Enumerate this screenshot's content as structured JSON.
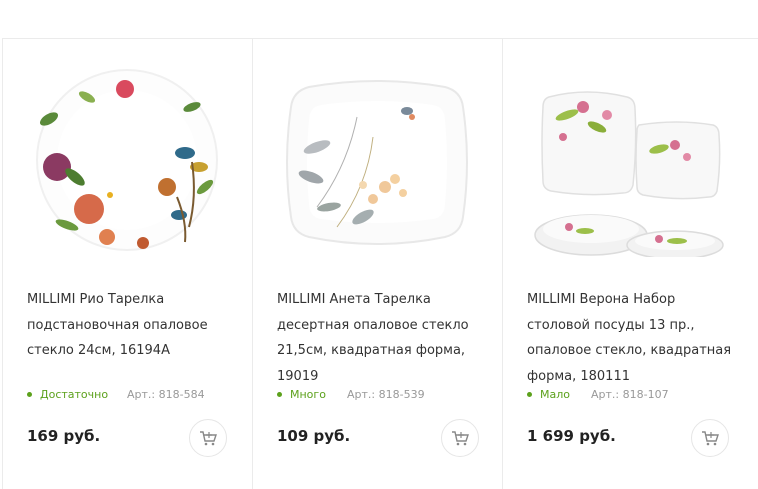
{
  "products": [
    {
      "title": "MILLIMI Рио Тарелка подстановочная опаловое стекло 24см, 16194А",
      "stock": "Достаточно",
      "article": "Арт.: 818-584",
      "price": "169 руб.",
      "image_icon": "round-floral-plate"
    },
    {
      "title": "MILLIMI Анета Тарелка десертная опаловое стекло 21,5см, квадратная форма, 19019",
      "stock": "Много",
      "article": "Арт.: 818-539",
      "price": "109 руб.",
      "image_icon": "square-floral-plate"
    },
    {
      "title": "MILLIMI Верона Набор столовой посуды 13 пр., опаловое стекло, квадратная форма, 180111",
      "stock": "Мало",
      "article": "Арт.: 818-107",
      "price": "1 699 руб.",
      "image_icon": "dinnerware-set"
    }
  ],
  "colors": {
    "stock_green": "#5ca11c",
    "border": "#ebebeb",
    "price_text": "#222222",
    "cart_icon": "#888888"
  },
  "cart_icon": "cart-plus-icon"
}
